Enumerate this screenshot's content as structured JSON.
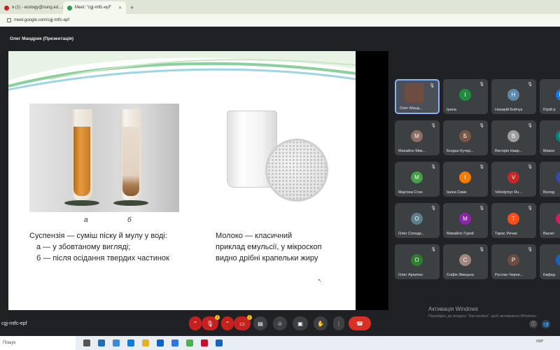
{
  "browser": {
    "tabs": [
      {
        "label": "я (1) - ecology@nung.ed..."
      },
      {
        "label": "Meet: \"cgj-mtfc-epf\""
      }
    ],
    "new_tab": "+",
    "url": "meet.google.com/cgj-mtfc-epf"
  },
  "meeting": {
    "presenter_label": "Олег Мандрик (Презентація)",
    "code": "cgj-mtfc-epf"
  },
  "slide": {
    "label_a": "а",
    "label_b": "б",
    "caption_left_1": "Суспензія — суміш піску й мулу у воді:",
    "caption_left_2": "а — у збовтаному вигляді;",
    "caption_left_3": "б — після осідання твердих частинок",
    "caption_right_1": "Молоко — класичний",
    "caption_right_2": "приклад емульсії, у мікроскоп",
    "caption_right_3": "видно дрібні крапельки жиру"
  },
  "participants": [
    {
      "name": "Олег Манд...",
      "initial": "",
      "color": "#6d4c41",
      "self": true
    },
    {
      "name": "Ірина",
      "initial": "І",
      "color": "#1e8e3e"
    },
    {
      "name": "Назарій Бойчук",
      "initial": "Н",
      "color": "#5f87a8"
    },
    {
      "name": "Юрій р",
      "initial": "Ю",
      "color": "#1a73e8"
    },
    {
      "name": "Михайло Мик...",
      "initial": "М",
      "color": "#8d6e63"
    },
    {
      "name": "Богдан Кучер...",
      "initial": "Б",
      "color": "#795548"
    },
    {
      "name": "Вікторія Навр...",
      "initial": "В",
      "color": "#9e9e9e"
    },
    {
      "name": "Микол",
      "initial": "М",
      "color": "#00897b"
    },
    {
      "name": "Мар'яна Стах",
      "initial": "М",
      "color": "#43a047"
    },
    {
      "name": "Ірина Смик",
      "initial": "І",
      "color": "#f57c00"
    },
    {
      "name": "Volodymyr Ru...",
      "initial": "V",
      "color": "#c62828"
    },
    {
      "name": "Волод",
      "initial": "В",
      "color": "#3949ab"
    },
    {
      "name": "Олег Солодк...",
      "initial": "О",
      "color": "#607d8b"
    },
    {
      "name": "Михайло Гурей",
      "initial": "М",
      "color": "#8e24aa"
    },
    {
      "name": "Тарас Ричак",
      "initial": "Т",
      "color": "#f4511e"
    },
    {
      "name": "Васил",
      "initial": "В",
      "color": "#d81b60"
    },
    {
      "name": "Олег Архипко",
      "initial": "О",
      "color": "#2e7d32"
    },
    {
      "name": "Софія Явецька",
      "initial": "С",
      "color": "#a1887f"
    },
    {
      "name": "Руслан Черне...",
      "initial": "Р",
      "color": "#6d4c41"
    },
    {
      "name": "Кафед",
      "initial": "К",
      "color": "#1565c0"
    }
  ],
  "windows": {
    "activation_title": "Активація Windows",
    "activation_sub": "Перейдіть до розділу \"Настройки\", щоб активувати Windows.",
    "search": "Пошук",
    "lang": "УКР"
  },
  "colors": {
    "accent": "#8ab4f8",
    "danger": "#d93025"
  }
}
